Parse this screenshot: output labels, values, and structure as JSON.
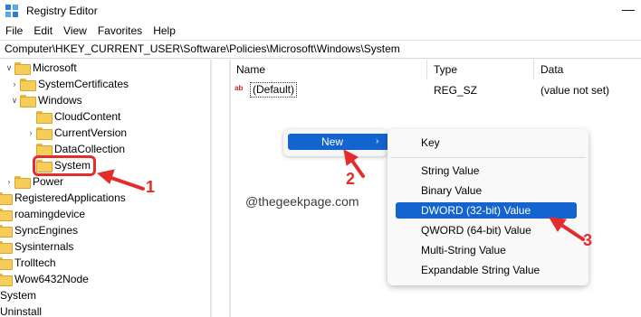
{
  "titlebar": {
    "title": "Registry Editor",
    "app_icon": "regedit-icon",
    "minimize_glyph": "—"
  },
  "menu": [
    "File",
    "Edit",
    "View",
    "Favorites",
    "Help"
  ],
  "address": "Computer\\HKEY_CURRENT_USER\\Software\\Policies\\Microsoft\\Windows\\System",
  "tree": [
    {
      "label": "Microsoft",
      "chevron": "down"
    },
    {
      "label": "SystemCertificates",
      "chevron": "right"
    },
    {
      "label": "Windows",
      "chevron": "down"
    },
    {
      "label": "CloudContent",
      "chevron": ""
    },
    {
      "label": "CurrentVersion",
      "chevron": "right"
    },
    {
      "label": "DataCollection",
      "chevron": ""
    },
    {
      "label": "System",
      "chevron": ""
    },
    {
      "label": "Power",
      "chevron": "right"
    },
    {
      "label": "RegisteredApplications",
      "chevron": ""
    },
    {
      "label": "roamingdevice",
      "chevron": ""
    },
    {
      "label": "SyncEngines",
      "chevron": ""
    },
    {
      "label": "Sysinternals",
      "chevron": ""
    },
    {
      "label": "Trolltech",
      "chevron": ""
    },
    {
      "label": "Wow6432Node",
      "chevron": ""
    },
    {
      "label": "System",
      "chevron": ""
    },
    {
      "label": "Uninstall",
      "chevron": ""
    }
  ],
  "list": {
    "headers": {
      "name": "Name",
      "type": "Type",
      "data": "Data"
    },
    "rows": [
      {
        "icon": "ab",
        "name": "(Default)",
        "type": "REG_SZ",
        "data": "(value not set)"
      }
    ]
  },
  "watermark": "@thegeekpage.com",
  "context_menu": {
    "new_label": "New",
    "new_chevron": "›"
  },
  "submenu": {
    "items": [
      "Key",
      "String Value",
      "Binary Value",
      "DWORD (32-bit) Value",
      "QWORD (64-bit) Value",
      "Multi-String Value",
      "Expandable String Value"
    ],
    "highlighted": "DWORD (32-bit) Value"
  },
  "annotations": {
    "step1": "1",
    "step2": "2",
    "step3": "3",
    "color": "#e32d2d"
  },
  "colors": {
    "selection": "#1464cf",
    "folder": "#f6cd58",
    "annotation": "#e32d2d"
  }
}
